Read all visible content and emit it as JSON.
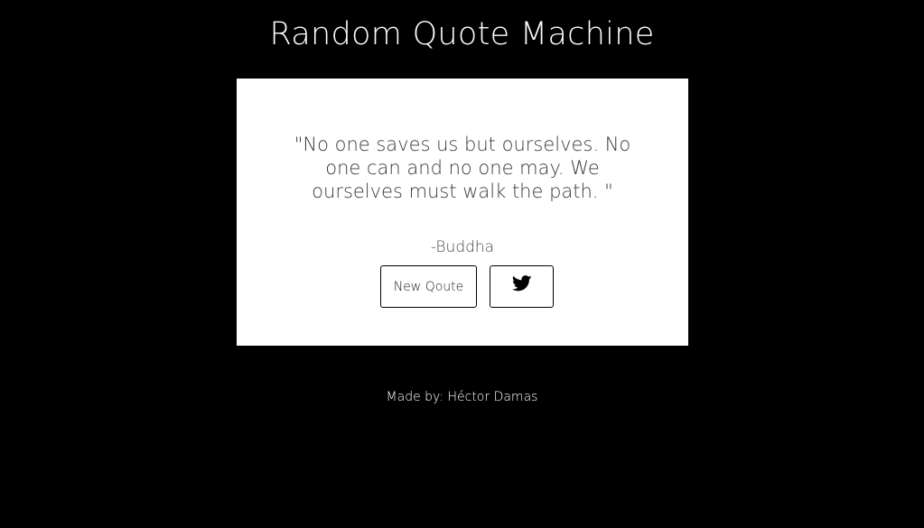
{
  "app": {
    "title": "Random Quote Machine"
  },
  "quote": {
    "text": "\"No one saves us but ourselves. No one can and no one may. We ourselves must walk the path. \"",
    "author": "-Buddha"
  },
  "buttons": {
    "new_quote_label": "New Qoute",
    "tweet_icon": "twitter-icon"
  },
  "footer": {
    "text": "Made by: Héctor Damas"
  },
  "colors": {
    "background": "#000000",
    "card": "#ffffff",
    "text_dark": "#3a3a3a",
    "footer_text": "#ffffff"
  }
}
